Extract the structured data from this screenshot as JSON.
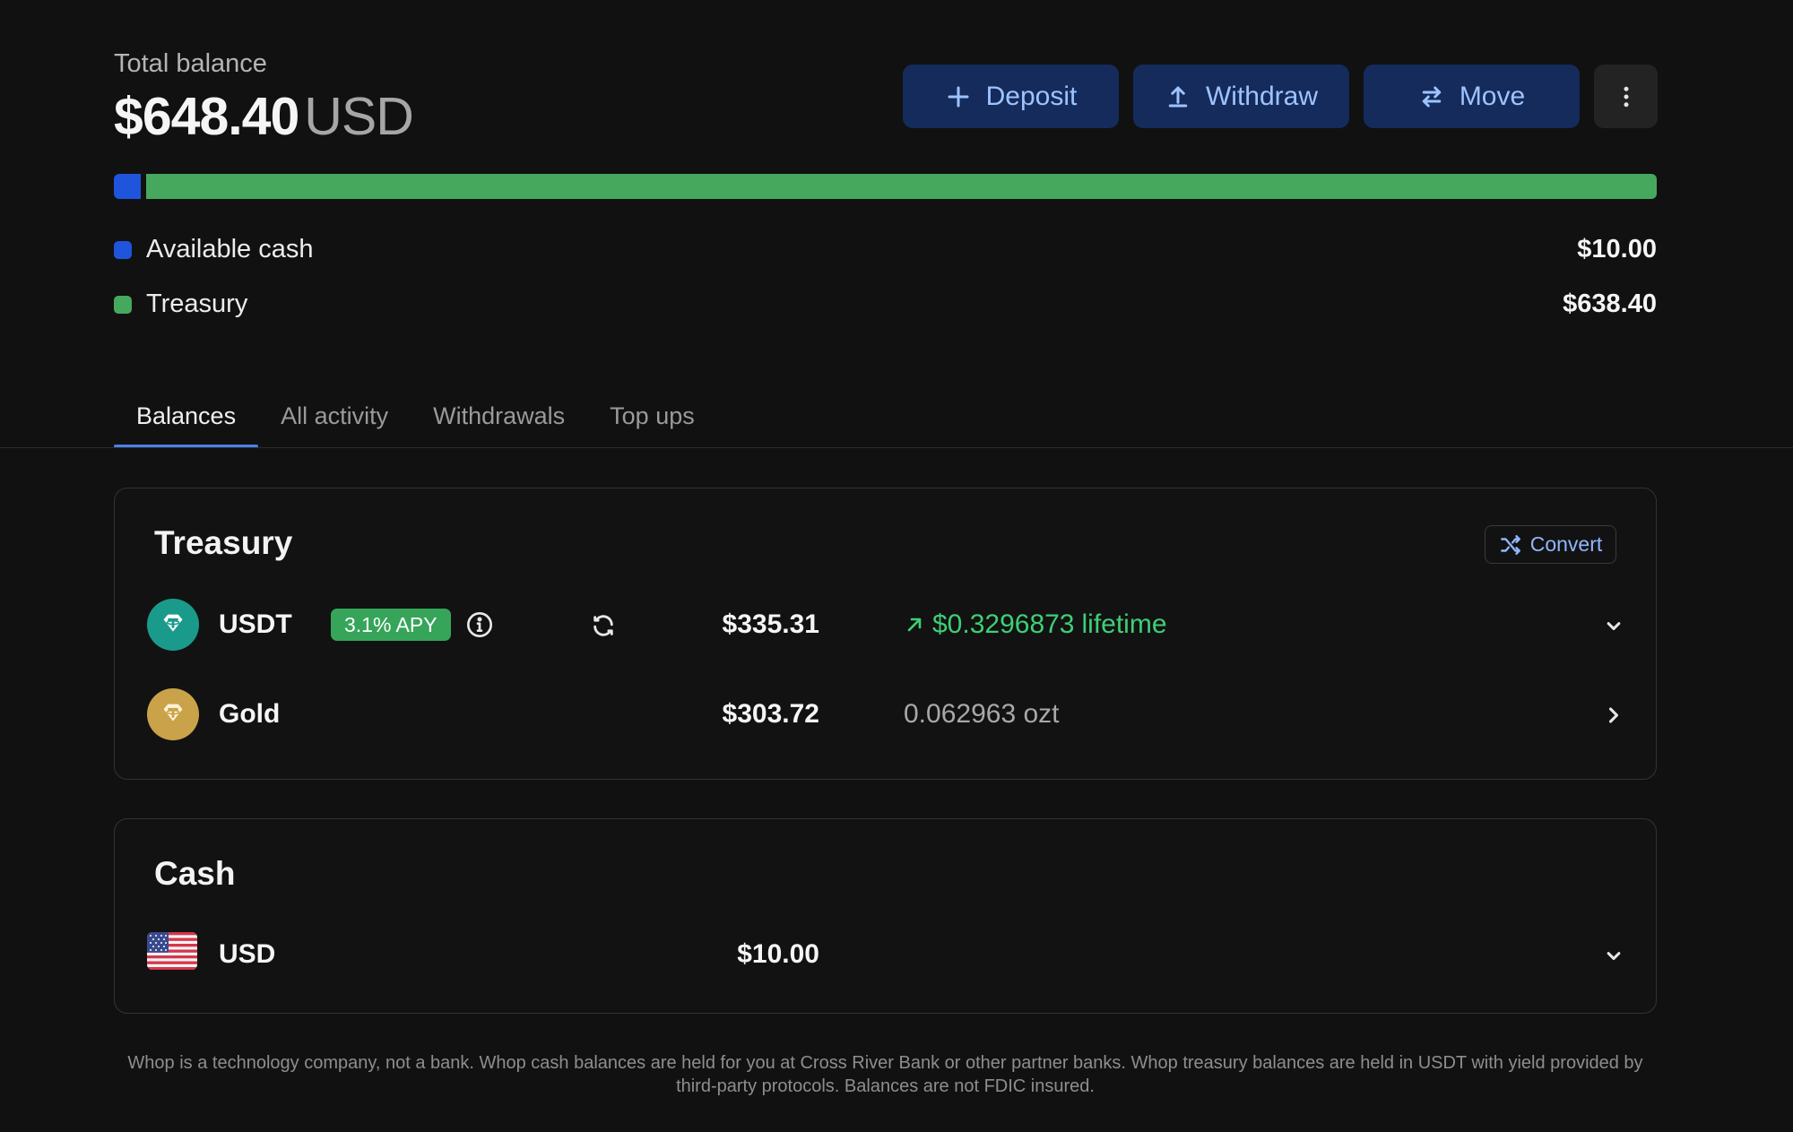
{
  "header": {
    "total_label": "Total balance",
    "total_amount": "$648.40",
    "total_currency": "USD",
    "actions": {
      "deposit": "Deposit",
      "withdraw": "Withdraw",
      "move": "Move"
    }
  },
  "allocation": {
    "cash_fraction": 0.0154,
    "cash_color": "#1f54dc",
    "treasury_color": "#46a85d",
    "legend": [
      {
        "label": "Available cash",
        "value": "$10.00"
      },
      {
        "label": "Treasury",
        "value": "$638.40"
      }
    ]
  },
  "tabs": [
    {
      "label": "Balances",
      "active": true
    },
    {
      "label": "All activity",
      "active": false
    },
    {
      "label": "Withdrawals",
      "active": false
    },
    {
      "label": "Top ups",
      "active": false
    }
  ],
  "treasury": {
    "title": "Treasury",
    "convert_label": "Convert",
    "usdt": {
      "name": "USDT",
      "apy": "3.1% APY",
      "amount": "$335.31",
      "yield_value": "$0.3296873",
      "yield_suffix": "lifetime",
      "coin_color": "#1a9a8b"
    },
    "gold": {
      "name": "Gold",
      "amount": "$303.72",
      "quantity": "0.062963 ozt",
      "coin_color": "#c9a24a"
    }
  },
  "cash": {
    "title": "Cash",
    "usd": {
      "name": "USD",
      "amount": "$10.00"
    }
  },
  "footer": {
    "disclaimer": "Whop is a technology company, not a bank. Whop cash balances are held for you at Cross River Bank or other partner banks. Whop treasury balances are held in USDT with yield provided by third-party protocols. Balances are not FDIC insured."
  }
}
